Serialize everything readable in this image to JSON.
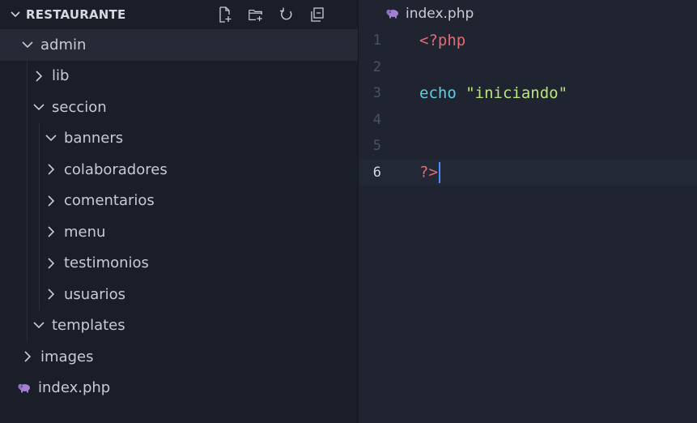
{
  "explorer": {
    "title": "RESTAURANTE",
    "actions": [
      {
        "name": "new-file-icon"
      },
      {
        "name": "new-folder-icon"
      },
      {
        "name": "refresh-icon"
      },
      {
        "name": "collapse-all-icon"
      }
    ],
    "items": [
      {
        "label": "admin",
        "depth": 0,
        "type": "folder",
        "open": true,
        "selected": true
      },
      {
        "label": "lib",
        "depth": 1,
        "type": "folder",
        "open": false
      },
      {
        "label": "seccion",
        "depth": 1,
        "type": "folder",
        "open": true
      },
      {
        "label": "banners",
        "depth": 2,
        "type": "folder",
        "open": true
      },
      {
        "label": "colaboradores",
        "depth": 2,
        "type": "folder",
        "open": false
      },
      {
        "label": "comentarios",
        "depth": 2,
        "type": "folder",
        "open": false
      },
      {
        "label": "menu",
        "depth": 2,
        "type": "folder",
        "open": false
      },
      {
        "label": "testimonios",
        "depth": 2,
        "type": "folder",
        "open": false
      },
      {
        "label": "usuarios",
        "depth": 2,
        "type": "folder",
        "open": false
      },
      {
        "label": "templates",
        "depth": 1,
        "type": "folder",
        "open": true
      },
      {
        "label": "images",
        "depth": 0,
        "type": "folder",
        "open": false
      },
      {
        "label": "index.php",
        "depth": 0,
        "type": "php-file"
      }
    ]
  },
  "editor": {
    "tab_label": "index.php",
    "current_line": 6,
    "lines": [
      {
        "number": "1",
        "tokens": [
          {
            "text": "<?php",
            "kind": "tag"
          }
        ]
      },
      {
        "number": "2",
        "tokens": []
      },
      {
        "number": "3",
        "tokens": [
          {
            "text": "echo",
            "kind": "kw"
          },
          {
            "text": " ",
            "kind": "plain"
          },
          {
            "text": "\"iniciando\"",
            "kind": "str"
          }
        ]
      },
      {
        "number": "4",
        "tokens": []
      },
      {
        "number": "5",
        "tokens": []
      },
      {
        "number": "6",
        "tokens": [
          {
            "text": "?>",
            "kind": "tag"
          }
        ],
        "caret": true
      }
    ]
  },
  "colors": {
    "sidebar_bg": "#1a1e28",
    "editor_bg": "#1f2430",
    "php_tag": "#e06c75",
    "keyword": "#5ccfe6",
    "string": "#bae67e",
    "caret": "#528bff"
  }
}
